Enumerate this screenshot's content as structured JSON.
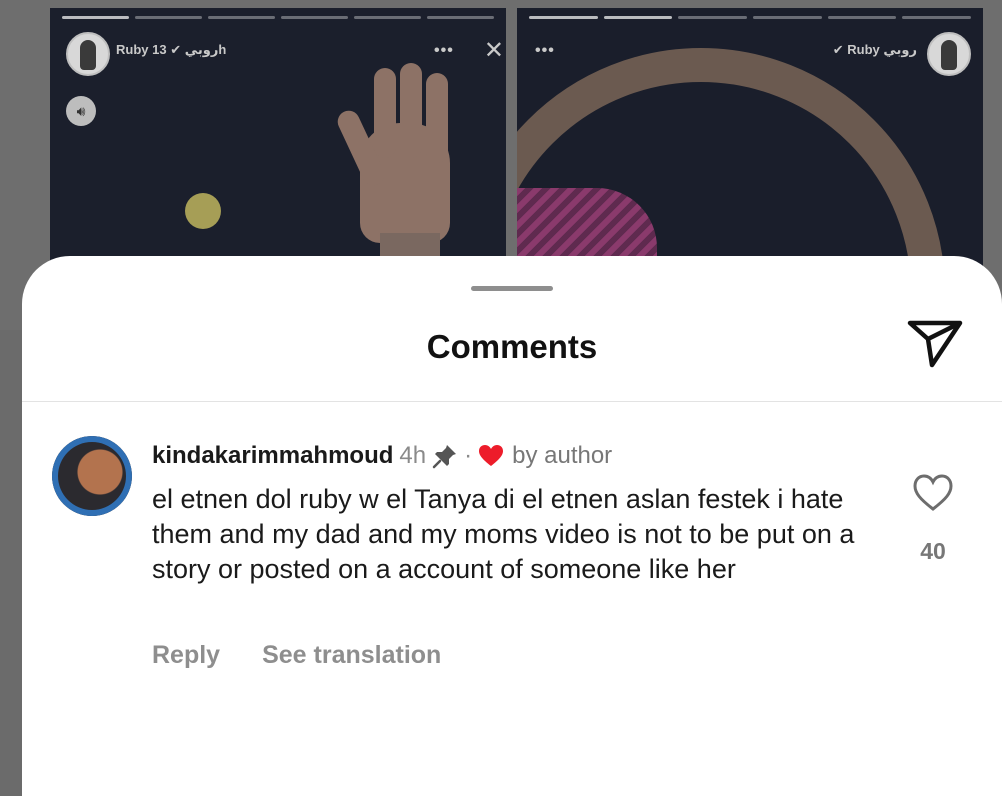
{
  "stories": {
    "left": {
      "user": "Ruby روبي",
      "time": "13h",
      "more": "•••",
      "close": "✕"
    },
    "right": {
      "user": "Ruby روبي",
      "more": "•••"
    }
  },
  "sheet": {
    "title": "Comments"
  },
  "comment": {
    "username": "kindakarimmahmoud",
    "time_ago": "4h",
    "separator": "·",
    "by_author": "by author",
    "text": "el etnen dol ruby w el Tanya di el etnen aslan festek i hate them and my dad and my moms video is not to be put on a story or posted on a account of someone like her",
    "reply_label": "Reply",
    "translate_label": "See translation",
    "like_count": "40"
  },
  "icons": {
    "send": "send-icon",
    "pin": "pin-icon",
    "author_heart": "heart-filled-icon",
    "like": "heart-outline-icon"
  },
  "colors": {
    "author_heart": "#ed1c2a",
    "sheet_bg": "#ffffff",
    "muted_text": "#8e8e8e"
  }
}
